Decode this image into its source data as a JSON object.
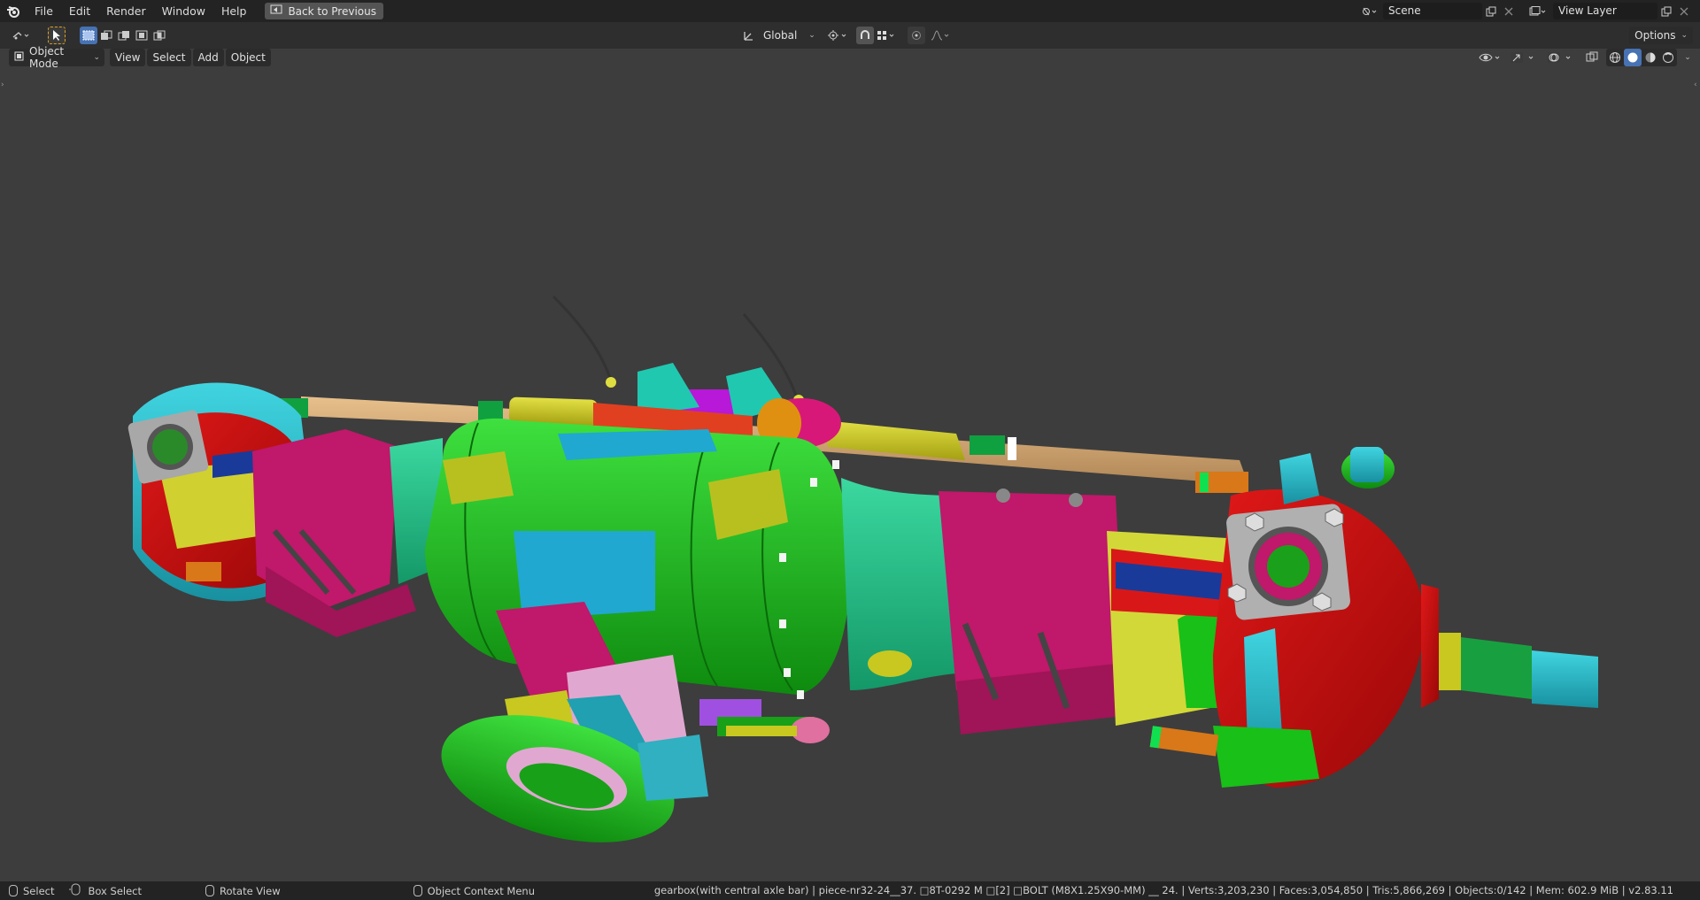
{
  "menu": {
    "items": [
      "File",
      "Edit",
      "Render",
      "Window",
      "Help"
    ],
    "back_button": "Back to Previous"
  },
  "scene": {
    "label": "Scene"
  },
  "view_layer": {
    "label": "View Layer"
  },
  "toolbar": {
    "transform_orientation": "Global",
    "options_label": "Options"
  },
  "header": {
    "mode": "Object Mode",
    "menus": [
      "View",
      "Select",
      "Add",
      "Object"
    ]
  },
  "status": {
    "select": "Select",
    "box_select": "Box Select",
    "rotate_view": "Rotate View",
    "context_menu": "Object Context Menu",
    "info": "gearbox(with central axle bar) | piece-nr32-24__37. □8T-0292 M □[2] □BOLT (M8X1.25X90-MM) __ 24. | Verts:3,203,230 | Faces:3,054,850 | Tris:5,866,269 | Objects:0/142 | Mem: 602.9 MiB | v2.83.11"
  },
  "colors": {
    "viewport_bg": "#3d3d3d",
    "topbar_bg": "#232323",
    "accent_blue": "#4772b3"
  }
}
